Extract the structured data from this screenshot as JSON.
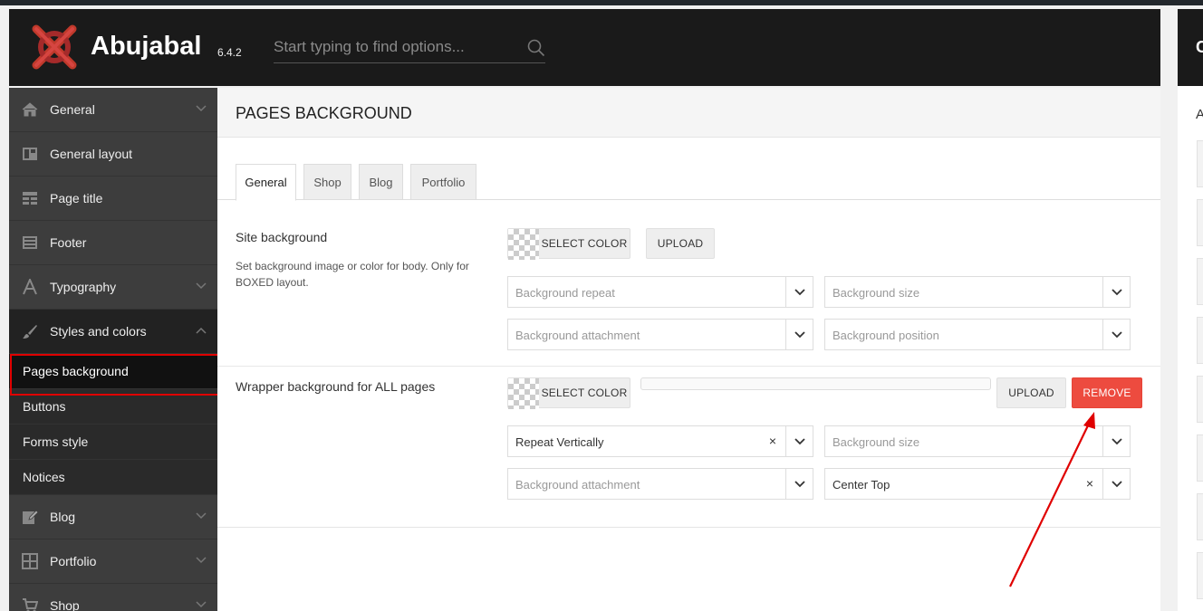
{
  "app": {
    "name": "Abujabal",
    "version": "6.4.2"
  },
  "search": {
    "placeholder": "Start typing to find options..."
  },
  "right_panel": {
    "title": "C",
    "letter": "A"
  },
  "sidebar": {
    "items": [
      {
        "label": "General",
        "icon": "home-icon",
        "chevron": "down"
      },
      {
        "label": "General layout",
        "icon": "layout-icon",
        "chevron": ""
      },
      {
        "label": "Page title",
        "icon": "page-title-icon",
        "chevron": ""
      },
      {
        "label": "Footer",
        "icon": "footer-icon",
        "chevron": ""
      },
      {
        "label": "Typography",
        "icon": "typography-icon",
        "chevron": "down"
      },
      {
        "label": "Styles and colors",
        "icon": "brush-icon",
        "chevron": "up"
      }
    ],
    "sub_items": [
      "Pages background",
      "Buttons",
      "Forms style",
      "Notices"
    ],
    "items_after": [
      {
        "label": "Blog",
        "icon": "edit-icon",
        "chevron": "down"
      },
      {
        "label": "Portfolio",
        "icon": "grid-icon",
        "chevron": "down"
      },
      {
        "label": "Shop",
        "icon": "cart-icon",
        "chevron": "down"
      }
    ]
  },
  "main": {
    "title": "PAGES BACKGROUND",
    "tabs": [
      "General",
      "Shop",
      "Blog",
      "Portfolio"
    ],
    "site_background": {
      "title": "Site background",
      "desc": "Set background image or color for body. Only for BOXED layout.",
      "select_color": "SELECT COLOR",
      "upload": "UPLOAD",
      "repeat_placeholder": "Background repeat",
      "size_placeholder": "Background size",
      "attachment_placeholder": "Background attachment",
      "position_placeholder": "Background position"
    },
    "wrapper_background": {
      "title": "Wrapper background for ALL pages",
      "select_color": "SELECT COLOR",
      "upload": "UPLOAD",
      "remove": "REMOVE",
      "repeat_value": "Repeat Vertically",
      "size_placeholder": "Background size",
      "attachment_placeholder": "Background attachment",
      "position_value": "Center Top",
      "clear_glyph": "×"
    }
  },
  "colors": {
    "remove_button": "#ed4b3f",
    "header": "#1a1a1a",
    "sidebar": "#3d3d3d",
    "annotation": "#e00000"
  }
}
